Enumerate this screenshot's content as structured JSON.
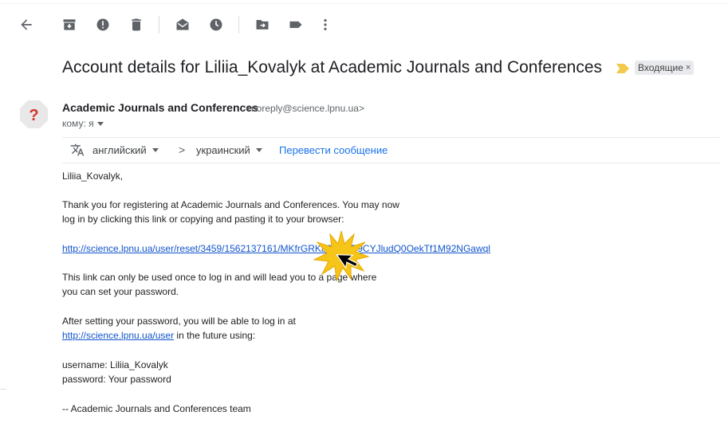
{
  "toolbar": {
    "icons": [
      "back-arrow-icon",
      "archive-icon",
      "report-spam-icon",
      "delete-icon",
      "mark-unread-icon",
      "snooze-icon",
      "move-to-icon",
      "label-icon",
      "more-vert-icon"
    ],
    "icon_color": "#5f6368"
  },
  "email": {
    "subject": "Account details for Liliia_Kovalyk at Academic Journals and Conferences",
    "label": "Входящие",
    "label_close": "×",
    "importance_color": "#f2c94c",
    "sender": {
      "name": "Academic Journals and Conferences",
      "email": "<noreply@science.lpnu.ua>",
      "avatar_glyph": "?",
      "avatar_glyph_color": "#d93025"
    },
    "to_line": "кому: я"
  },
  "translate": {
    "source_lang": "английский",
    "arrow": ">",
    "target_lang": "украинский",
    "action": "Перевести сообщение",
    "link_color": "#1a73e8"
  },
  "body": {
    "greeting": "Liliia_Kovalyk,",
    "para1_line1": "Thank you for registering at Academic Journals and Conferences. You may now",
    "para1_line2": "log in by clicking this link or copying and pasting it to your browser:",
    "reset_link": "http://science.lpnu.ua/user/reset/3459/1562137161/MKfrGRKa2plvNP9CYJludQ0OekTf1M92NGawql",
    "para2_line1": "This link can only be used once to log in and will lead you to a page where",
    "para2_line2": "you can set your password.",
    "para3_line1": "After setting your password, you will be able to log in at",
    "user_link": "http://science.lpnu.ua/user",
    "para3_line2_suffix": " in the future using:",
    "username_line": "username: Liliia_Kovalyk",
    "password_line": "password: Your password",
    "signature": "--  Academic Journals and Conferences team",
    "link_color": "#1155cc"
  }
}
